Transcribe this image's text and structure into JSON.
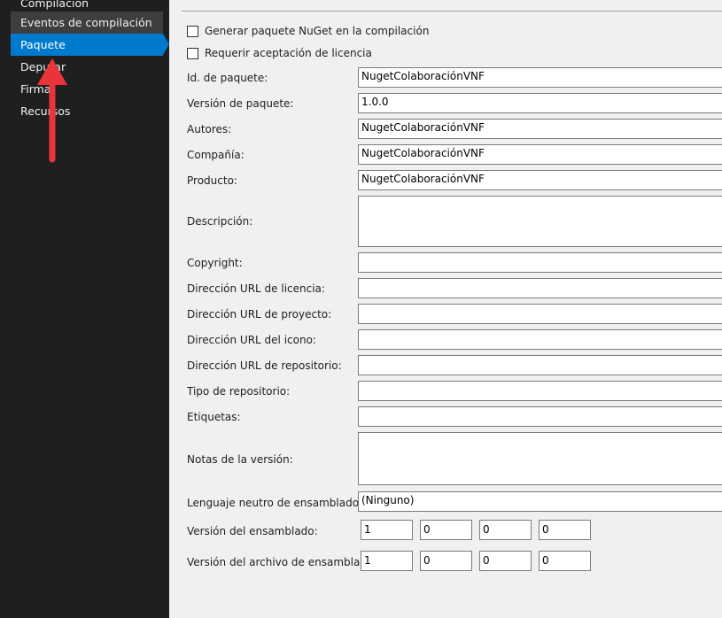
{
  "sidebar": {
    "items": [
      {
        "label": "Compilación"
      },
      {
        "label": "Eventos de compilación"
      },
      {
        "label": "Paquete"
      },
      {
        "label": "Depurar"
      },
      {
        "label": "Firma"
      },
      {
        "label": "Recursos"
      }
    ],
    "selected": "Paquete",
    "arrow_color": "#e8343a",
    "accent": "#007acc"
  },
  "form": {
    "generate_nuget_label": "Generar paquete NuGet en la compilación",
    "require_license_label": "Requerir aceptación de licencia",
    "fields": {
      "package_id": {
        "label": "Id. de paquete:",
        "value": "NugetColaboraciónVNF"
      },
      "package_version": {
        "label": "Versión de paquete:",
        "value": "1.0.0"
      },
      "authors": {
        "label": "Autores:",
        "value": "NugetColaboraciónVNF"
      },
      "company": {
        "label": "Compañía:",
        "value": "NugetColaboraciónVNF"
      },
      "product": {
        "label": "Producto:",
        "value": "NugetColaboraciónVNF"
      },
      "description": {
        "label": "Descripción:",
        "value": ""
      },
      "copyright": {
        "label": "Copyright:",
        "value": ""
      },
      "license_url": {
        "label": "Dirección URL de licencia:",
        "value": ""
      },
      "project_url": {
        "label": "Dirección URL de proyecto:",
        "value": ""
      },
      "icon_url": {
        "label": "Dirección URL del icono:",
        "value": ""
      },
      "repository_url": {
        "label": "Dirección URL de repositorio:",
        "value": ""
      },
      "repository_type": {
        "label": "Tipo de repositorio:",
        "value": ""
      },
      "tags": {
        "label": "Etiquetas:",
        "value": ""
      },
      "release_notes": {
        "label": "Notas de la versión:",
        "value": ""
      },
      "neutral_language": {
        "label": "Lenguaje neutro de ensamblado:",
        "value": "(Ninguno)"
      }
    },
    "assembly_version": {
      "label": "Versión del ensamblado:",
      "values": [
        "1",
        "0",
        "0",
        "0"
      ]
    },
    "file_version": {
      "label": "Versión del archivo de ensamblado:",
      "values": [
        "1",
        "0",
        "0",
        "0"
      ]
    }
  }
}
